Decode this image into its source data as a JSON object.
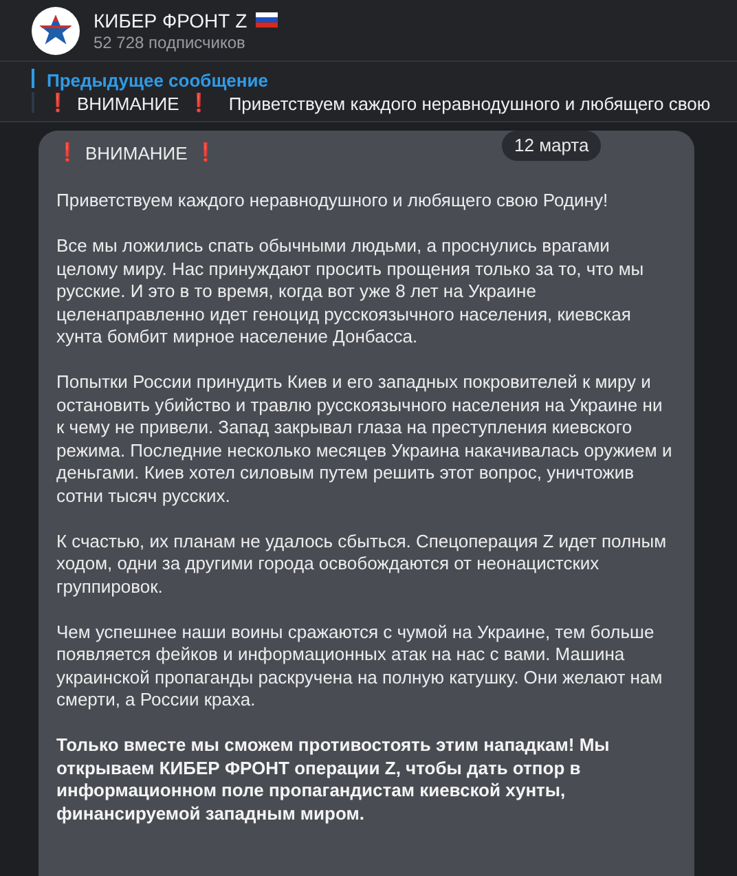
{
  "channel": {
    "title": "КИБЕР ФРОНТ Z",
    "subscribers": "52 728 подписчиков"
  },
  "pinned": {
    "label": "Предыдущее сообщение",
    "marker": "❗",
    "heading": "ВНИМАНИЕ",
    "preview": "Приветствуем каждого неравнодушного и любящего свою"
  },
  "message": {
    "date": "12 марта",
    "marker": "❗",
    "heading": "ВНИМАНИЕ",
    "paragraphs": [
      {
        "text": "Приветствуем каждого неравнодушного и любящего свою Родину!",
        "bold": false
      },
      {
        "text": "Все мы ложились спать обычными людьми, а проснулись врагами целому миру. Нас принуждают просить прощения только за то, что мы русские. И это в то время, когда вот уже 8 лет на Украине целенаправленно идет геноцид русскоязычного населения, киевская хунта бомбит мирное население Донбасса.",
        "bold": false
      },
      {
        "text": "Попытки России принудить Киев и его западных покровителей к миру и остановить убийство и травлю русскоязычного населения на Украине ни к чему не привели. Запад закрывал глаза на преступления киевского режима. Последние несколько месяцев Украина накачивалась оружием и деньгами. Киев хотел силовым путем решить этот вопрос, уничтожив сотни тысяч русских.",
        "bold": false
      },
      {
        "text": "К счастью, их планам не удалось сбыться. Спецоперация Z идет полным ходом, одни за другими города освобождаются от неонацистских группировок.",
        "bold": false
      },
      {
        "text": "Чем успешнее наши воины сражаются с чумой на Украине, тем больше появляется фейков и информационных атак на нас с вами. Машина украинской пропаганды раскручена на полную катушку. Они желают нам смерти, а России краха.",
        "bold": false
      },
      {
        "text": "Только вместе мы сможем противостоять этим нападкам! Мы открываем КИБЕР ФРОНТ операции Z, чтобы дать отпор в информационном поле пропагандистам киевской хунты, финансируемой западным миром.",
        "bold": true
      }
    ]
  }
}
